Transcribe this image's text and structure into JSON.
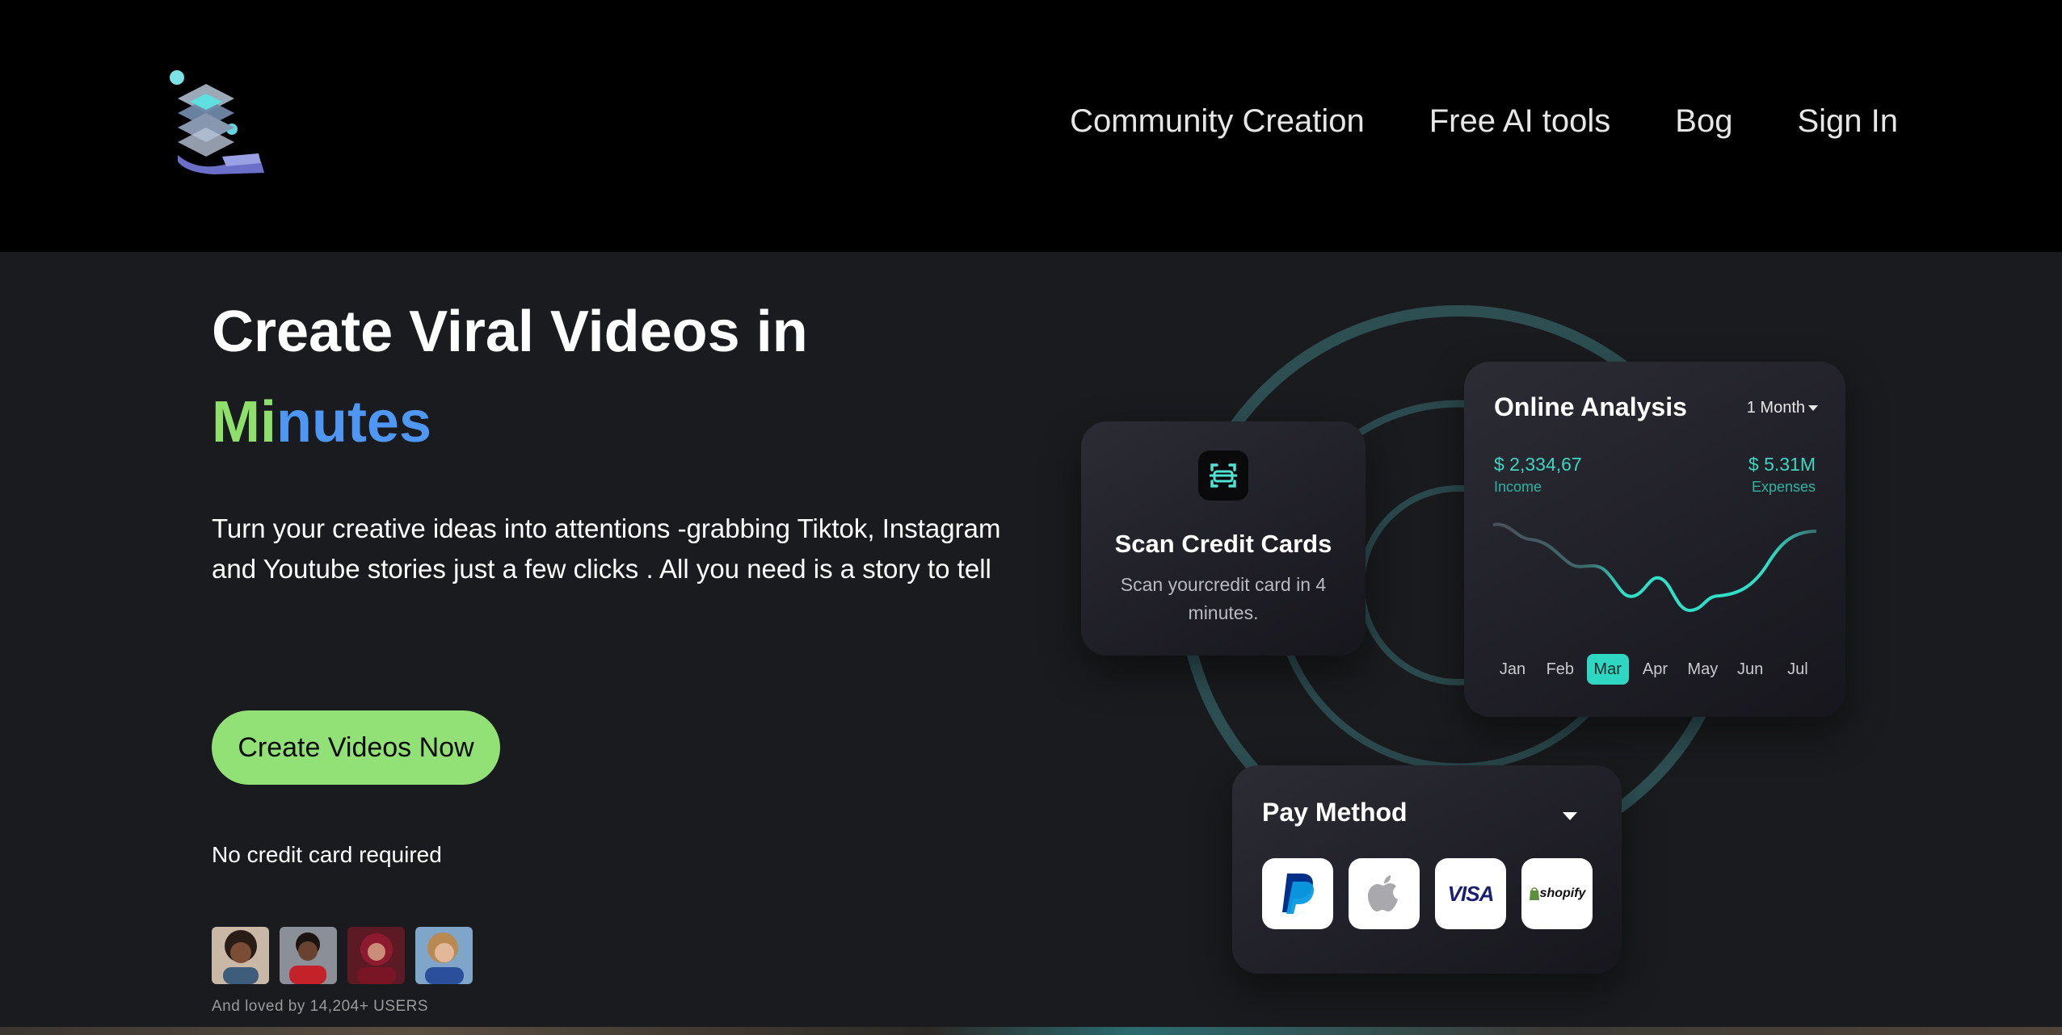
{
  "nav": {
    "links": [
      "Community Creation",
      "Free AI tools",
      "Bog",
      "Sign In"
    ],
    "logo_icon": "layered-stack-hand-logo"
  },
  "hero": {
    "title_line1": "Create Viral Videos in",
    "title_line2_a": "Mi",
    "title_line2_b": "nutes",
    "description": "Turn your creative ideas into attentions -grabbing Tiktok, Instagram and Youtube stories just a few clicks . All you need is a story to tell",
    "cta_label": "Create Videos Now",
    "note": "No credit card required",
    "loved_by": "And loved by 14,204+ USERS",
    "colors": {
      "accent_green": "#8ee06a",
      "accent_blue": "#4f97f5",
      "cta_bg": "#91e176"
    }
  },
  "scan_card": {
    "title": "Scan Credit Cards",
    "subtitle": "Scan yourcredit card in 4 minutes.",
    "icon": "scan-card-icon"
  },
  "analysis_card": {
    "title": "Online Analysis",
    "period": "1 Month",
    "income_value": "$ 2,334,67",
    "income_label": "Income",
    "expense_value": "$ 5.31M",
    "expense_label": "Expenses",
    "months": [
      "Jan",
      "Feb",
      "Mar",
      "Apr",
      "May",
      "Jun",
      "Jul"
    ],
    "active_month": "Mar",
    "accent": "#2fd7c3"
  },
  "pay_card": {
    "title": "Pay Method",
    "methods": [
      {
        "name": "paypal",
        "icon": "paypal-icon"
      },
      {
        "name": "apple",
        "icon": "apple-icon"
      },
      {
        "name": "visa",
        "label": "VISA"
      },
      {
        "name": "shopify",
        "label": "shopify"
      }
    ]
  }
}
